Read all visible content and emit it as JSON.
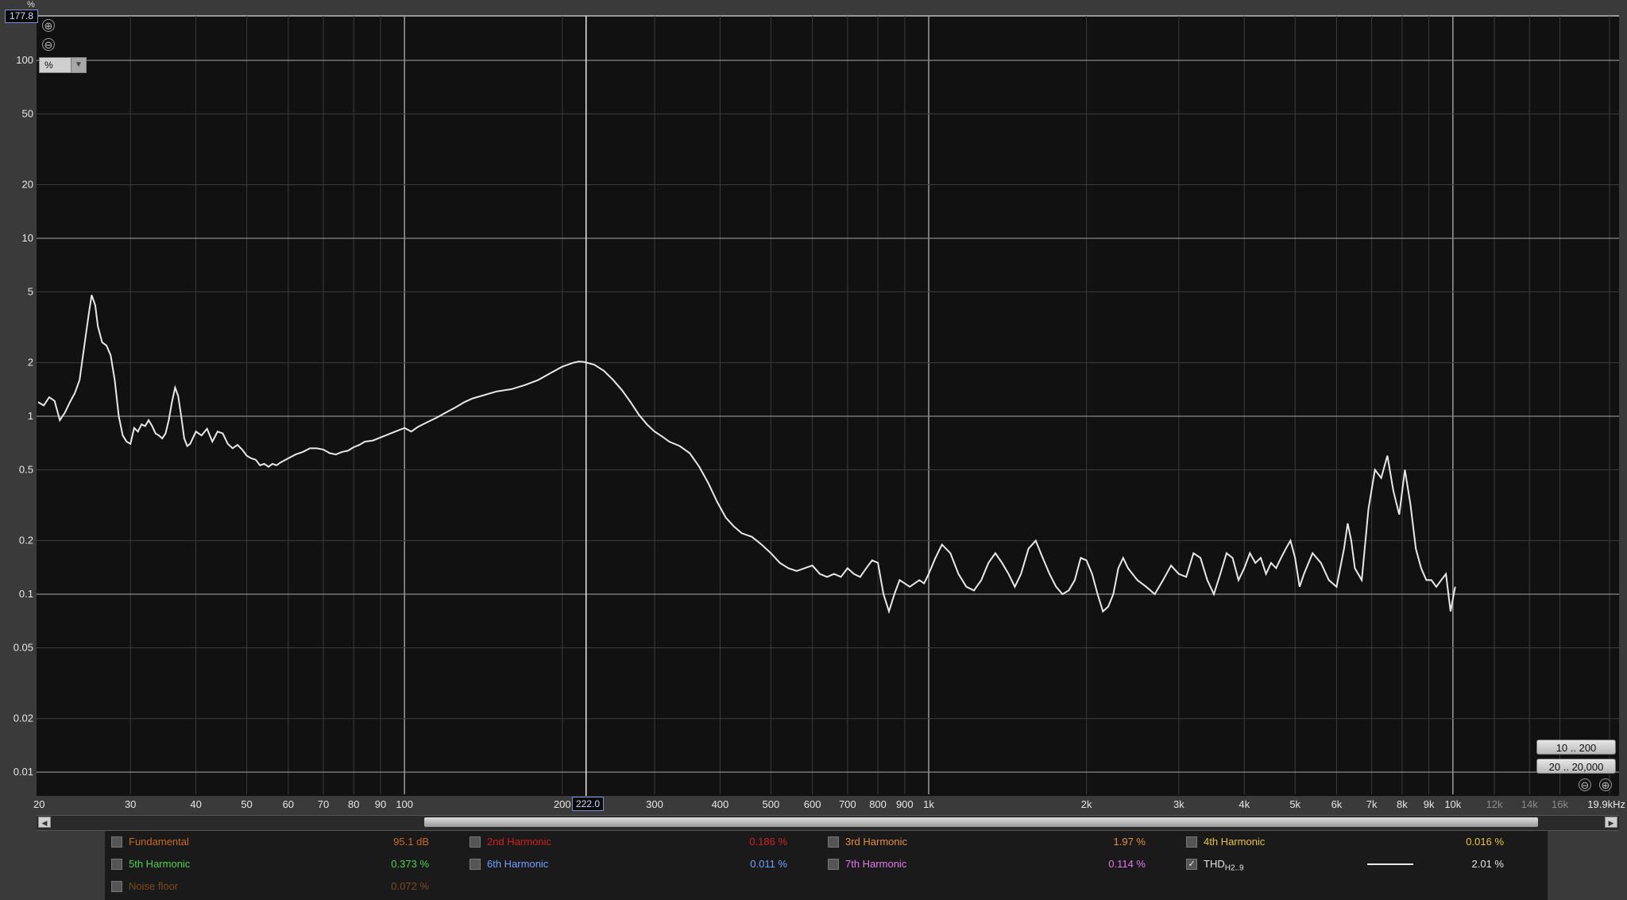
{
  "app": {
    "y_unit_label": "%",
    "y_top_value": "177.8",
    "unit_selector": "%",
    "zoom_in_symbol": "⊕",
    "zoom_out_symbol": "⊖",
    "cursor_frequency": "222.0",
    "range_buttons": [
      "10 .. 200",
      "20 .. 20,000"
    ],
    "icons": {
      "zoom_in": "zoom-in-icon",
      "zoom_out": "zoom-out-icon",
      "dropdown": "chevron-down-icon",
      "scroll_left": "triangle-left-icon",
      "scroll_right": "triangle-right-icon",
      "checkbox_checked": "check-icon"
    }
  },
  "chart_data": {
    "type": "line",
    "x_scale": "log",
    "y_scale": "log",
    "xlim": [
      20,
      19900
    ],
    "ylim": [
      0.0075,
      100
    ],
    "grid": true,
    "cursor_x": 222.0,
    "x_ticks": [
      {
        "v": 20,
        "label": "20"
      },
      {
        "v": 30,
        "label": "30"
      },
      {
        "v": 40,
        "label": "40"
      },
      {
        "v": 50,
        "label": "50"
      },
      {
        "v": 60,
        "label": "60"
      },
      {
        "v": 70,
        "label": "70"
      },
      {
        "v": 80,
        "label": "80"
      },
      {
        "v": 90,
        "label": "90"
      },
      {
        "v": 100,
        "label": "100"
      },
      {
        "v": 200,
        "label": "200"
      },
      {
        "v": 300,
        "label": "300"
      },
      {
        "v": 400,
        "label": "400"
      },
      {
        "v": 500,
        "label": "500"
      },
      {
        "v": 600,
        "label": "600"
      },
      {
        "v": 700,
        "label": "700"
      },
      {
        "v": 800,
        "label": "800"
      },
      {
        "v": 900,
        "label": "900"
      },
      {
        "v": 1000,
        "label": "1k"
      },
      {
        "v": 2000,
        "label": "2k"
      },
      {
        "v": 3000,
        "label": "3k"
      },
      {
        "v": 4000,
        "label": "4k"
      },
      {
        "v": 5000,
        "label": "5k"
      },
      {
        "v": 6000,
        "label": "6k"
      },
      {
        "v": 7000,
        "label": "7k"
      },
      {
        "v": 8000,
        "label": "8k"
      },
      {
        "v": 9000,
        "label": "9k"
      },
      {
        "v": 10000,
        "label": "10k"
      },
      {
        "v": 12000,
        "label": "12k",
        "dim": true
      },
      {
        "v": 14000,
        "label": "14k",
        "dim": true
      },
      {
        "v": 16000,
        "label": "16k",
        "dim": true
      },
      {
        "v": 19900,
        "label": "19.9kHz"
      }
    ],
    "y_ticks": [
      {
        "v": 100,
        "label": "100"
      },
      {
        "v": 50,
        "label": "50"
      },
      {
        "v": 20,
        "label": "20"
      },
      {
        "v": 10,
        "label": "10"
      },
      {
        "v": 5,
        "label": "5"
      },
      {
        "v": 2,
        "label": "2"
      },
      {
        "v": 1,
        "label": "1"
      },
      {
        "v": 0.5,
        "label": "0.5"
      },
      {
        "v": 0.2,
        "label": "0.2"
      },
      {
        "v": 0.1,
        "label": "0.1"
      },
      {
        "v": 0.05,
        "label": "0.05"
      },
      {
        "v": 0.02,
        "label": "0.02"
      },
      {
        "v": 0.01,
        "label": "0.01"
      }
    ],
    "series": [
      {
        "name": "THDH2..9",
        "color": "#e8e8e8",
        "points": [
          [
            20,
            1.2
          ],
          [
            20.5,
            1.15
          ],
          [
            21,
            1.28
          ],
          [
            21.5,
            1.22
          ],
          [
            22,
            0.95
          ],
          [
            22.5,
            1.05
          ],
          [
            23,
            1.2
          ],
          [
            23.5,
            1.35
          ],
          [
            24,
            1.6
          ],
          [
            24.5,
            2.5
          ],
          [
            25,
            3.8
          ],
          [
            25.3,
            4.8
          ],
          [
            25.7,
            4.2
          ],
          [
            26,
            3.2
          ],
          [
            26.5,
            2.6
          ],
          [
            27,
            2.5
          ],
          [
            27.5,
            2.2
          ],
          [
            28,
            1.6
          ],
          [
            28.5,
            1.0
          ],
          [
            29,
            0.78
          ],
          [
            29.5,
            0.72
          ],
          [
            30,
            0.7
          ],
          [
            30.5,
            0.86
          ],
          [
            31,
            0.82
          ],
          [
            31.5,
            0.9
          ],
          [
            32,
            0.88
          ],
          [
            32.5,
            0.95
          ],
          [
            33,
            0.88
          ],
          [
            33.5,
            0.8
          ],
          [
            34,
            0.78
          ],
          [
            34.5,
            0.75
          ],
          [
            35,
            0.8
          ],
          [
            35.5,
            0.95
          ],
          [
            36,
            1.2
          ],
          [
            36.5,
            1.45
          ],
          [
            37,
            1.3
          ],
          [
            37.5,
            1.0
          ],
          [
            38,
            0.75
          ],
          [
            38.5,
            0.68
          ],
          [
            39,
            0.7
          ],
          [
            40,
            0.82
          ],
          [
            41,
            0.78
          ],
          [
            42,
            0.85
          ],
          [
            43,
            0.72
          ],
          [
            44,
            0.82
          ],
          [
            45,
            0.8
          ],
          [
            46,
            0.7
          ],
          [
            47,
            0.66
          ],
          [
            48,
            0.69
          ],
          [
            49,
            0.65
          ],
          [
            50,
            0.6
          ],
          [
            51,
            0.58
          ],
          [
            52,
            0.57
          ],
          [
            53,
            0.53
          ],
          [
            54,
            0.54
          ],
          [
            55,
            0.52
          ],
          [
            56,
            0.54
          ],
          [
            57,
            0.53
          ],
          [
            58,
            0.55
          ],
          [
            60,
            0.58
          ],
          [
            62,
            0.61
          ],
          [
            64,
            0.63
          ],
          [
            66,
            0.66
          ],
          [
            68,
            0.66
          ],
          [
            70,
            0.65
          ],
          [
            72,
            0.62
          ],
          [
            74,
            0.61
          ],
          [
            76,
            0.63
          ],
          [
            78,
            0.64
          ],
          [
            80,
            0.67
          ],
          [
            82,
            0.69
          ],
          [
            84,
            0.72
          ],
          [
            87,
            0.73
          ],
          [
            90,
            0.76
          ],
          [
            93,
            0.79
          ],
          [
            96,
            0.82
          ],
          [
            100,
            0.86
          ],
          [
            103,
            0.82
          ],
          [
            106,
            0.87
          ],
          [
            110,
            0.92
          ],
          [
            115,
            0.98
          ],
          [
            120,
            1.05
          ],
          [
            125,
            1.12
          ],
          [
            130,
            1.2
          ],
          [
            135,
            1.26
          ],
          [
            140,
            1.3
          ],
          [
            150,
            1.38
          ],
          [
            160,
            1.42
          ],
          [
            170,
            1.5
          ],
          [
            180,
            1.6
          ],
          [
            190,
            1.75
          ],
          [
            200,
            1.9
          ],
          [
            210,
            2.0
          ],
          [
            215,
            2.03
          ],
          [
            220,
            2.02
          ],
          [
            230,
            1.95
          ],
          [
            240,
            1.8
          ],
          [
            250,
            1.6
          ],
          [
            260,
            1.4
          ],
          [
            270,
            1.2
          ],
          [
            280,
            1.02
          ],
          [
            290,
            0.9
          ],
          [
            300,
            0.82
          ],
          [
            310,
            0.77
          ],
          [
            320,
            0.72
          ],
          [
            335,
            0.68
          ],
          [
            350,
            0.62
          ],
          [
            365,
            0.52
          ],
          [
            380,
            0.42
          ],
          [
            395,
            0.33
          ],
          [
            410,
            0.27
          ],
          [
            425,
            0.24
          ],
          [
            440,
            0.22
          ],
          [
            460,
            0.21
          ],
          [
            480,
            0.19
          ],
          [
            500,
            0.17
          ],
          [
            520,
            0.15
          ],
          [
            540,
            0.14
          ],
          [
            560,
            0.135
          ],
          [
            580,
            0.14
          ],
          [
            600,
            0.145
          ],
          [
            620,
            0.13
          ],
          [
            640,
            0.125
          ],
          [
            660,
            0.13
          ],
          [
            680,
            0.125
          ],
          [
            700,
            0.14
          ],
          [
            720,
            0.13
          ],
          [
            740,
            0.125
          ],
          [
            760,
            0.14
          ],
          [
            780,
            0.155
          ],
          [
            800,
            0.15
          ],
          [
            820,
            0.1
          ],
          [
            840,
            0.08
          ],
          [
            860,
            0.1
          ],
          [
            880,
            0.12
          ],
          [
            900,
            0.115
          ],
          [
            920,
            0.11
          ],
          [
            940,
            0.115
          ],
          [
            960,
            0.12
          ],
          [
            980,
            0.115
          ],
          [
            1000,
            0.13
          ],
          [
            1030,
            0.16
          ],
          [
            1060,
            0.19
          ],
          [
            1100,
            0.17
          ],
          [
            1140,
            0.13
          ],
          [
            1180,
            0.11
          ],
          [
            1220,
            0.105
          ],
          [
            1260,
            0.12
          ],
          [
            1300,
            0.15
          ],
          [
            1340,
            0.17
          ],
          [
            1380,
            0.15
          ],
          [
            1420,
            0.13
          ],
          [
            1460,
            0.11
          ],
          [
            1500,
            0.13
          ],
          [
            1550,
            0.18
          ],
          [
            1600,
            0.2
          ],
          [
            1650,
            0.16
          ],
          [
            1700,
            0.13
          ],
          [
            1750,
            0.11
          ],
          [
            1800,
            0.1
          ],
          [
            1850,
            0.105
          ],
          [
            1900,
            0.12
          ],
          [
            1950,
            0.16
          ],
          [
            2000,
            0.155
          ],
          [
            2050,
            0.13
          ],
          [
            2100,
            0.1
          ],
          [
            2150,
            0.08
          ],
          [
            2200,
            0.085
          ],
          [
            2250,
            0.1
          ],
          [
            2300,
            0.14
          ],
          [
            2350,
            0.16
          ],
          [
            2400,
            0.14
          ],
          [
            2500,
            0.12
          ],
          [
            2600,
            0.11
          ],
          [
            2700,
            0.1
          ],
          [
            2800,
            0.12
          ],
          [
            2900,
            0.145
          ],
          [
            3000,
            0.13
          ],
          [
            3100,
            0.125
          ],
          [
            3200,
            0.17
          ],
          [
            3300,
            0.16
          ],
          [
            3400,
            0.12
          ],
          [
            3500,
            0.1
          ],
          [
            3600,
            0.13
          ],
          [
            3700,
            0.17
          ],
          [
            3800,
            0.16
          ],
          [
            3900,
            0.12
          ],
          [
            4000,
            0.14
          ],
          [
            4100,
            0.17
          ],
          [
            4200,
            0.15
          ],
          [
            4300,
            0.16
          ],
          [
            4400,
            0.13
          ],
          [
            4500,
            0.15
          ],
          [
            4600,
            0.14
          ],
          [
            4700,
            0.16
          ],
          [
            4800,
            0.18
          ],
          [
            4900,
            0.2
          ],
          [
            5000,
            0.16
          ],
          [
            5100,
            0.11
          ],
          [
            5200,
            0.13
          ],
          [
            5400,
            0.17
          ],
          [
            5600,
            0.15
          ],
          [
            5800,
            0.12
          ],
          [
            6000,
            0.11
          ],
          [
            6200,
            0.18
          ],
          [
            6300,
            0.25
          ],
          [
            6400,
            0.2
          ],
          [
            6500,
            0.14
          ],
          [
            6700,
            0.12
          ],
          [
            6900,
            0.3
          ],
          [
            7100,
            0.5
          ],
          [
            7300,
            0.45
          ],
          [
            7500,
            0.6
          ],
          [
            7700,
            0.38
          ],
          [
            7900,
            0.28
          ],
          [
            8100,
            0.5
          ],
          [
            8300,
            0.32
          ],
          [
            8500,
            0.18
          ],
          [
            8700,
            0.14
          ],
          [
            8900,
            0.12
          ],
          [
            9100,
            0.12
          ],
          [
            9300,
            0.11
          ],
          [
            9500,
            0.12
          ],
          [
            9700,
            0.13
          ],
          [
            9900,
            0.08
          ],
          [
            10100,
            0.11
          ]
        ]
      }
    ]
  },
  "legend": [
    {
      "key": "fundamental",
      "label": "Fundamental",
      "value": "95.1 dB",
      "color": "#c86a1e",
      "checked": false,
      "row": 0,
      "col": 0
    },
    {
      "key": "h2",
      "label": "2nd Harmonic",
      "value": "0.186 %",
      "color": "#d22020",
      "checked": false,
      "row": 0,
      "col": 1
    },
    {
      "key": "h3",
      "label": "3rd Harmonic",
      "value": "1.97 %",
      "color": "#e09040",
      "checked": false,
      "row": 0,
      "col": 2
    },
    {
      "key": "h4",
      "label": "4th Harmonic",
      "value": "0.016 %",
      "color": "#e8c23a",
      "checked": false,
      "row": 0,
      "col": 3
    },
    {
      "key": "h5",
      "label": "5th Harmonic",
      "value": "0.373 %",
      "color": "#4cd24c",
      "checked": false,
      "row": 1,
      "col": 0
    },
    {
      "key": "h6",
      "label": "6th Harmonic",
      "value": "0.011 %",
      "color": "#6fa0ff",
      "checked": false,
      "row": 1,
      "col": 1
    },
    {
      "key": "h7",
      "label": "7th Harmonic",
      "value": "0.114 %",
      "color": "#e07ae8",
      "checked": false,
      "row": 1,
      "col": 2
    },
    {
      "key": "thd",
      "label": "THD",
      "label_sub": "H2..9",
      "value": "2.01 %",
      "color": "#e8e8e8",
      "checked": true,
      "row": 1,
      "col": 3
    },
    {
      "key": "noise",
      "label": "Noise floor",
      "value": "0.072 %",
      "color": "#7a4a20",
      "checked": false,
      "row": 2,
      "col": 0
    }
  ]
}
